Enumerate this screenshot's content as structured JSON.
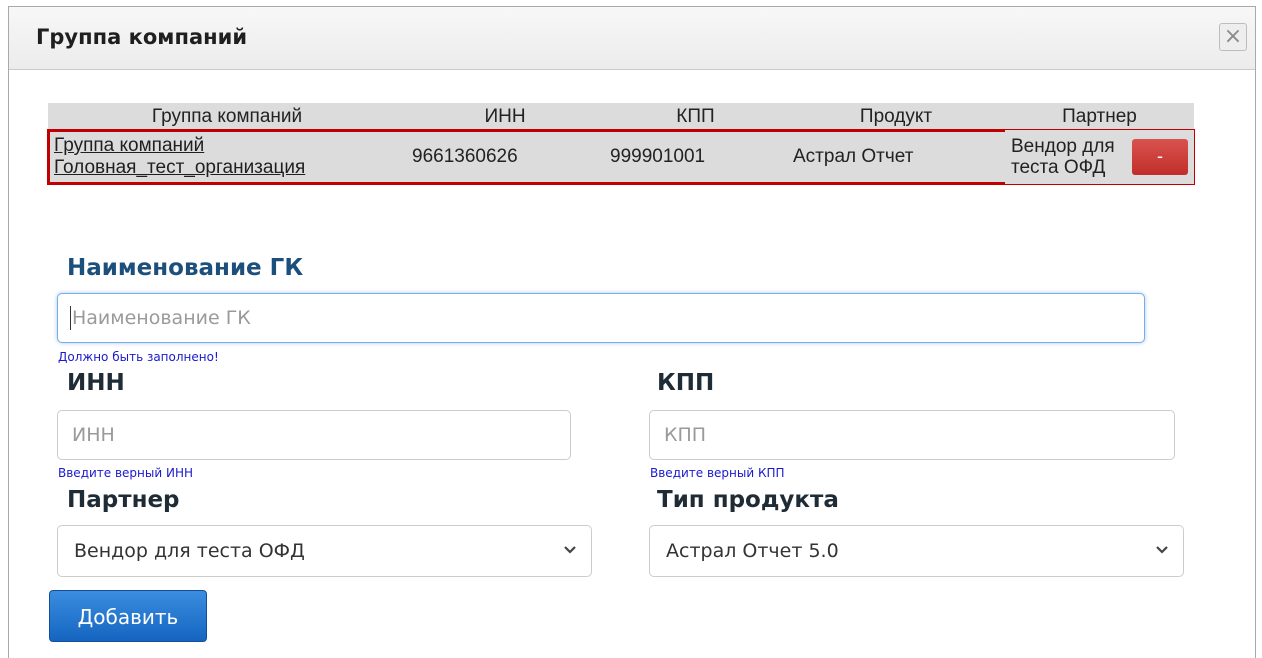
{
  "dialog": {
    "title": "Группа компаний",
    "close_glyph": "×"
  },
  "table": {
    "headers": [
      "Группа компаний",
      "ИНН",
      "КПП",
      "Продукт",
      "Партнер"
    ],
    "row": {
      "company_line1": "Группа компаний",
      "company_line2": "Головная_тест_организация",
      "inn": "9661360626",
      "kpp": "999901001",
      "product": "Астрал Отчет",
      "partner_line1": "Вендор для",
      "partner_line2": "теста ОФД",
      "remove_label": "-"
    }
  },
  "form": {
    "name_label": "Наименование ГК",
    "name_placeholder": "Наименование ГК",
    "name_hint": "Должно быть заполнено!",
    "inn_label": "ИНН",
    "inn_placeholder": "ИНН",
    "inn_hint": "Введите верный ИНН",
    "kpp_label": "КПП",
    "kpp_placeholder": "КПП",
    "kpp_hint": "Введите верный КПП",
    "partner_label": "Партнер",
    "partner_value": "Вендор для теста ОФД",
    "product_label": "Тип продукта",
    "product_value": "Астрал Отчет 5.0",
    "submit_label": "Добавить"
  },
  "colors": {
    "accent": "#1565c0",
    "danger": "#c9302c",
    "highlight_border": "#c00000",
    "label": "#1c4f7c",
    "hint": "#1a1acc"
  },
  "icons": {
    "close": "close-icon",
    "dropdown": "chevron-down-icon"
  }
}
